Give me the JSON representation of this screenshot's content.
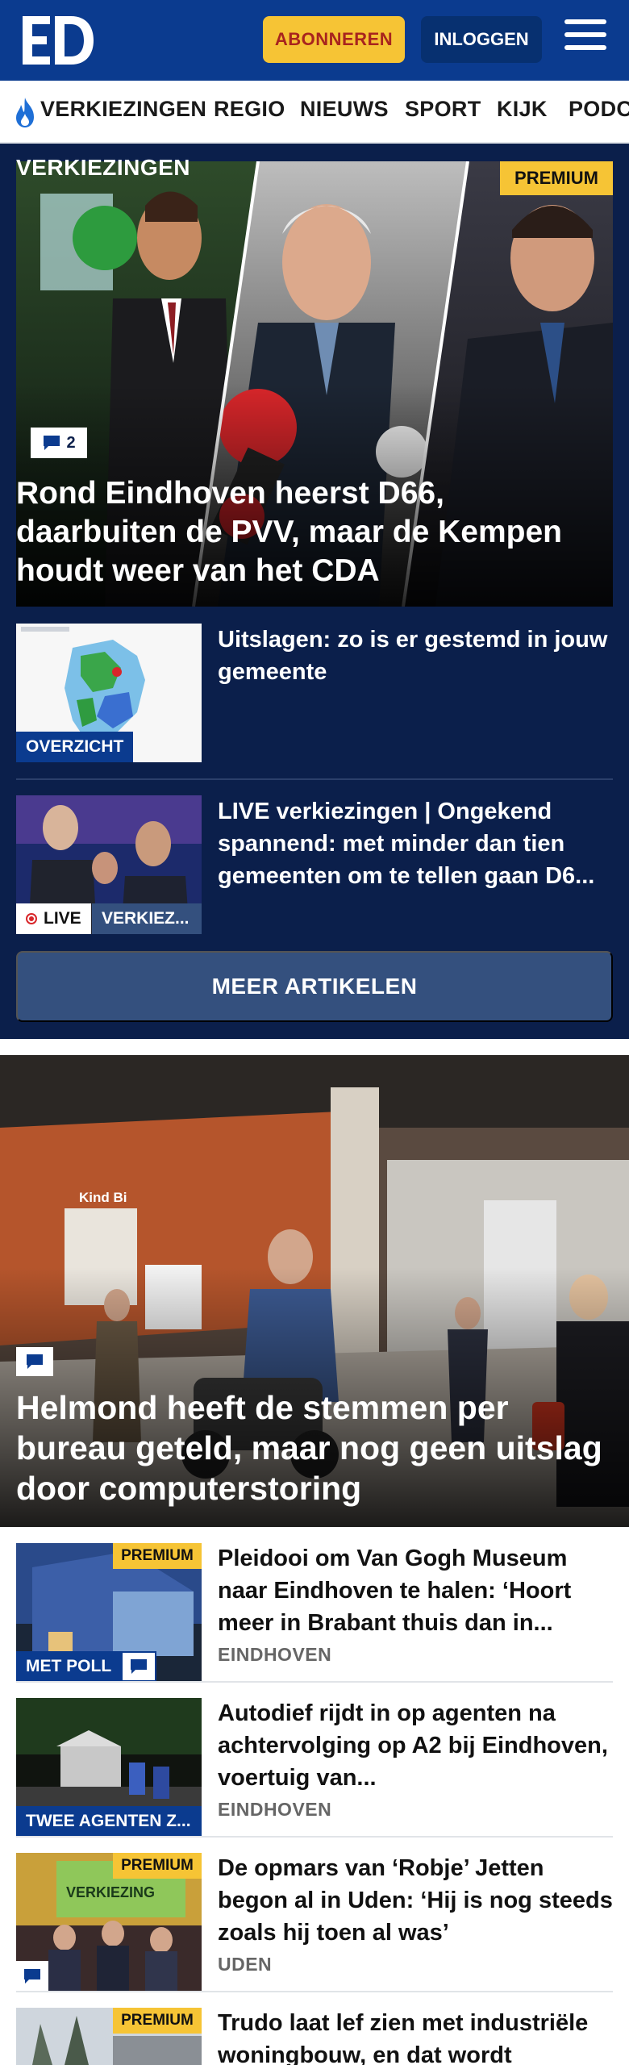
{
  "header": {
    "logo_text": "ED",
    "subscribe_label": "ABONNEREN",
    "login_label": "INLOGGEN"
  },
  "nav": {
    "items": [
      "VERKIEZINGEN",
      "REGIO",
      "NIEUWS",
      "SPORT",
      "KIJK",
      "PODCASTS"
    ]
  },
  "election": {
    "section_label": "VERKIEZINGEN",
    "hero": {
      "premium": "PREMIUM",
      "comments": "2",
      "title": "Rond Eindhoven heerst D66, daarbuiten de PVV, maar de Kempen houdt weer van het CDA"
    },
    "articles": [
      {
        "badge": "OVERZICHT",
        "title": "Uitslagen: zo is er gestemd in jouw gemeente"
      },
      {
        "live": "LIVE",
        "tag": "VERKIEZ...",
        "title": "LIVE verkiezingen | Ongekend spannend: met minder dan tien gemeenten om te tellen gaan D6..."
      }
    ],
    "more_label": "MEER ARTIKELEN"
  },
  "hero2": {
    "title": "Helmond heeft de stemmen per bureau geteld, maar nog geen uitslag door computerstoring",
    "sign_text": "Kind Bi"
  },
  "articles": [
    {
      "premium": "PREMIUM",
      "badge": "MET POLL",
      "title": "Pleidooi om Van Gogh Museum naar Eindhoven te halen: ‘Hoort meer in Brabant thuis dan in...",
      "region": "EINDHOVEN"
    },
    {
      "badge": "TWEE AGENTEN Z...",
      "title": "Autodief rijdt in op agenten na achtervolging op A2 bij Eindhoven, voertuig van...",
      "region": "EINDHOVEN"
    },
    {
      "premium": "PREMIUM",
      "title": "De opmars van ‘Robje’ Jetten begon al in Uden: ‘Hij is nog steeds zoals hij toen al was’",
      "region": "UDEN",
      "thumb_text": "VERKIEZING"
    },
    {
      "premium": "PREMIUM",
      "title": "Trudo laat lef zien met indu­striële woningbouw, en dat wordt"
    }
  ],
  "colors": {
    "brand_blue": "#0b3b8f",
    "election_bg": "#0b1f4b",
    "premium_yellow": "#f6c435",
    "subscribe_text": "#a8241e"
  },
  "icons": [
    "ed-logo",
    "hamburger-menu-icon",
    "flame-icon",
    "comment-icon",
    "live-dot-icon"
  ]
}
